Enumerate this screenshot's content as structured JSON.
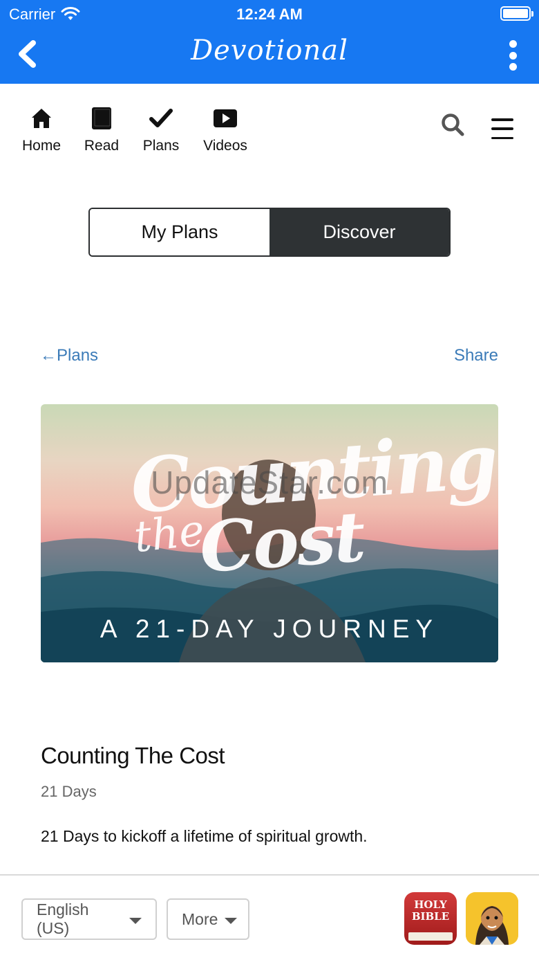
{
  "status_bar": {
    "carrier": "Carrier",
    "time": "12:24 AM"
  },
  "nav_bar": {
    "title": "Devotional"
  },
  "tab_nav": {
    "items": [
      {
        "label": "Home",
        "icon": "home-icon"
      },
      {
        "label": "Read",
        "icon": "book-icon"
      },
      {
        "label": "Plans",
        "icon": "check-icon"
      },
      {
        "label": "Videos",
        "icon": "play-icon"
      }
    ],
    "search_icon": "search-icon",
    "menu_icon": "hamburger-menu-icon"
  },
  "segmented": {
    "my_plans": "My Plans",
    "discover": "Discover",
    "selected": "Discover"
  },
  "links": {
    "back": "←Plans",
    "share": "Share"
  },
  "hero": {
    "line1": "Counting",
    "line2": "the",
    "line3": "Cost",
    "subtitle": "A 21-DAY JOURNEY",
    "watermark": "UpdateStar.com"
  },
  "plan": {
    "title": "Counting The Cost",
    "days": "21 Days",
    "description": "21 Days to kickoff a lifetime of spiritual growth."
  },
  "footer": {
    "language": "English (US)",
    "more": "More",
    "app1_text": "HOLY BIBLE"
  },
  "colors": {
    "header_blue": "#1778f2",
    "link_blue": "#3b7bb8",
    "segment_dark": "#2e3234"
  }
}
